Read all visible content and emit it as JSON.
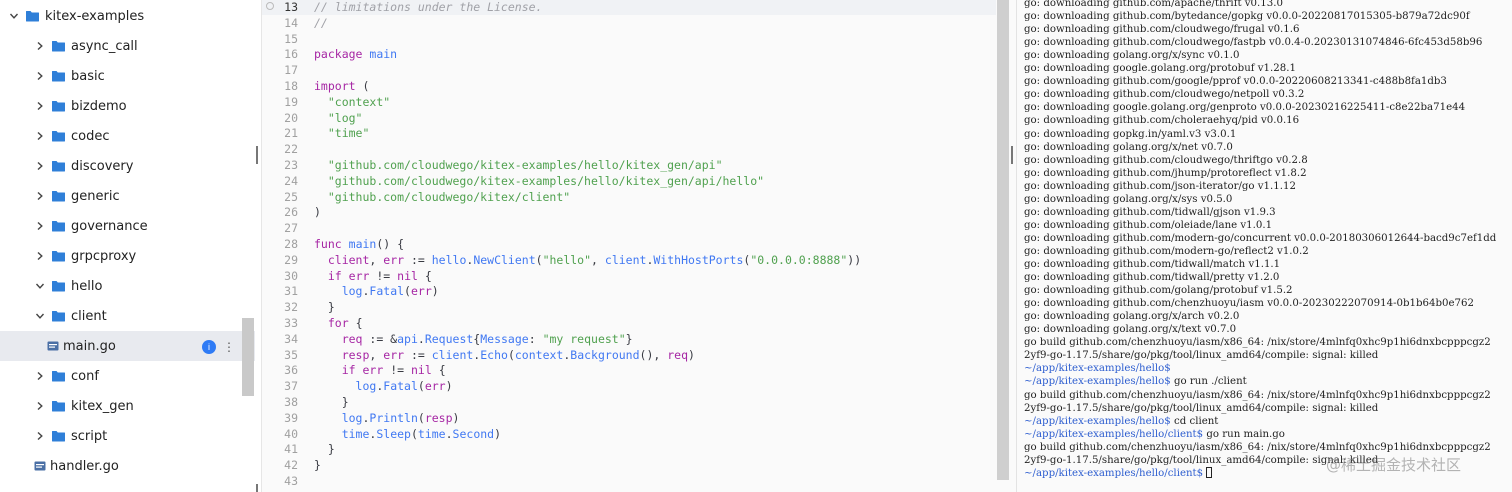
{
  "sidebar": {
    "items": [
      {
        "label": "kitex-examples",
        "type": "folder",
        "expanded": true,
        "depth": 0
      },
      {
        "label": "async_call",
        "type": "folder",
        "expanded": false,
        "depth": 1
      },
      {
        "label": "basic",
        "type": "folder",
        "expanded": false,
        "depth": 1
      },
      {
        "label": "bizdemo",
        "type": "folder",
        "expanded": false,
        "depth": 1
      },
      {
        "label": "codec",
        "type": "folder",
        "expanded": false,
        "depth": 1
      },
      {
        "label": "discovery",
        "type": "folder",
        "expanded": false,
        "depth": 1
      },
      {
        "label": "generic",
        "type": "folder",
        "expanded": false,
        "depth": 1
      },
      {
        "label": "governance",
        "type": "folder",
        "expanded": false,
        "depth": 1
      },
      {
        "label": "grpcproxy",
        "type": "folder",
        "expanded": false,
        "depth": 1
      },
      {
        "label": "hello",
        "type": "folder",
        "expanded": true,
        "depth": 1
      },
      {
        "label": "client",
        "type": "folder",
        "expanded": true,
        "depth": 2
      },
      {
        "label": "main.go",
        "type": "file",
        "selected": true,
        "depth": 3
      },
      {
        "label": "conf",
        "type": "folder",
        "expanded": false,
        "depth": 2
      },
      {
        "label": "kitex_gen",
        "type": "folder",
        "expanded": false,
        "depth": 2
      },
      {
        "label": "script",
        "type": "folder",
        "expanded": false,
        "depth": 2
      },
      {
        "label": "handler.go",
        "type": "file",
        "depth": 2
      }
    ],
    "badge_text": "i",
    "kebab_text": "⋮"
  },
  "editor": {
    "current_line": "13",
    "lines": [
      {
        "n": "13",
        "tokens": [
          [
            "cm",
            "// limitations under the License."
          ]
        ]
      },
      {
        "n": "14",
        "tokens": [
          [
            "cm",
            "//"
          ]
        ]
      },
      {
        "n": "15",
        "tokens": []
      },
      {
        "n": "16",
        "tokens": [
          [
            "kw",
            "package"
          ],
          [
            "op",
            " "
          ],
          [
            "fn",
            "main"
          ]
        ]
      },
      {
        "n": "17",
        "tokens": []
      },
      {
        "n": "18",
        "tokens": [
          [
            "kw",
            "import"
          ],
          [
            "op",
            " ("
          ]
        ]
      },
      {
        "n": "19",
        "tokens": [
          [
            "op",
            "  "
          ],
          [
            "str",
            "\"context\""
          ]
        ]
      },
      {
        "n": "20",
        "tokens": [
          [
            "op",
            "  "
          ],
          [
            "str",
            "\"log\""
          ]
        ]
      },
      {
        "n": "21",
        "tokens": [
          [
            "op",
            "  "
          ],
          [
            "str",
            "\"time\""
          ]
        ]
      },
      {
        "n": "22",
        "tokens": []
      },
      {
        "n": "23",
        "tokens": [
          [
            "op",
            "  "
          ],
          [
            "str",
            "\"github.com/cloudwego/kitex-examples/hello/kitex_gen/api\""
          ]
        ]
      },
      {
        "n": "24",
        "tokens": [
          [
            "op",
            "  "
          ],
          [
            "str",
            "\"github.com/cloudwego/kitex-examples/hello/kitex_gen/api/hello\""
          ]
        ]
      },
      {
        "n": "25",
        "tokens": [
          [
            "op",
            "  "
          ],
          [
            "str",
            "\"github.com/cloudwego/kitex/client\""
          ]
        ]
      },
      {
        "n": "26",
        "tokens": [
          [
            "op",
            ")"
          ]
        ]
      },
      {
        "n": "27",
        "tokens": []
      },
      {
        "n": "28",
        "tokens": [
          [
            "kw",
            "func"
          ],
          [
            "op",
            " "
          ],
          [
            "fn",
            "main"
          ],
          [
            "op",
            "() {"
          ]
        ]
      },
      {
        "n": "29",
        "tokens": [
          [
            "op",
            "  "
          ],
          [
            "kw",
            "client"
          ],
          [
            "op",
            ", "
          ],
          [
            "kw",
            "err"
          ],
          [
            "op",
            " := "
          ],
          [
            "fn",
            "hello"
          ],
          [
            "op",
            "."
          ],
          [
            "fn",
            "NewClient"
          ],
          [
            "op",
            "("
          ],
          [
            "str",
            "\"hello\""
          ],
          [
            "op",
            ", "
          ],
          [
            "fn",
            "client"
          ],
          [
            "op",
            "."
          ],
          [
            "fn",
            "WithHostPorts"
          ],
          [
            "op",
            "("
          ],
          [
            "str",
            "\"0.0.0.0:8888\""
          ],
          [
            "op",
            "))"
          ]
        ]
      },
      {
        "n": "30",
        "tokens": [
          [
            "op",
            "  "
          ],
          [
            "kw",
            "if"
          ],
          [
            "op",
            " "
          ],
          [
            "kw",
            "err"
          ],
          [
            "op",
            " != "
          ],
          [
            "kw",
            "nil"
          ],
          [
            "op",
            " {"
          ]
        ]
      },
      {
        "n": "31",
        "tokens": [
          [
            "op",
            "    "
          ],
          [
            "fn",
            "log"
          ],
          [
            "op",
            "."
          ],
          [
            "fn",
            "Fatal"
          ],
          [
            "op",
            "("
          ],
          [
            "kw",
            "err"
          ],
          [
            "op",
            ")"
          ]
        ]
      },
      {
        "n": "32",
        "tokens": [
          [
            "op",
            "  }"
          ]
        ]
      },
      {
        "n": "33",
        "tokens": [
          [
            "op",
            "  "
          ],
          [
            "kw",
            "for"
          ],
          [
            "op",
            " {"
          ]
        ]
      },
      {
        "n": "34",
        "tokens": [
          [
            "op",
            "    "
          ],
          [
            "kw",
            "req"
          ],
          [
            "op",
            " := &"
          ],
          [
            "fn",
            "api"
          ],
          [
            "op",
            "."
          ],
          [
            "fn",
            "Request"
          ],
          [
            "op",
            "{"
          ],
          [
            "fn",
            "Message"
          ],
          [
            "op",
            ": "
          ],
          [
            "str",
            "\"my request\""
          ],
          [
            "op",
            "}"
          ]
        ]
      },
      {
        "n": "35",
        "tokens": [
          [
            "op",
            "    "
          ],
          [
            "kw",
            "resp"
          ],
          [
            "op",
            ", "
          ],
          [
            "kw",
            "err"
          ],
          [
            "op",
            " := "
          ],
          [
            "fn",
            "client"
          ],
          [
            "op",
            "."
          ],
          [
            "fn",
            "Echo"
          ],
          [
            "op",
            "("
          ],
          [
            "fn",
            "context"
          ],
          [
            "op",
            "."
          ],
          [
            "fn",
            "Background"
          ],
          [
            "op",
            "(), "
          ],
          [
            "kw",
            "req"
          ],
          [
            "op",
            ")"
          ]
        ]
      },
      {
        "n": "36",
        "tokens": [
          [
            "op",
            "    "
          ],
          [
            "kw",
            "if"
          ],
          [
            "op",
            " "
          ],
          [
            "kw",
            "err"
          ],
          [
            "op",
            " != "
          ],
          [
            "kw",
            "nil"
          ],
          [
            "op",
            " {"
          ]
        ]
      },
      {
        "n": "37",
        "tokens": [
          [
            "op",
            "      "
          ],
          [
            "fn",
            "log"
          ],
          [
            "op",
            "."
          ],
          [
            "fn",
            "Fatal"
          ],
          [
            "op",
            "("
          ],
          [
            "kw",
            "err"
          ],
          [
            "op",
            ")"
          ]
        ]
      },
      {
        "n": "38",
        "tokens": [
          [
            "op",
            "    }"
          ]
        ]
      },
      {
        "n": "39",
        "tokens": [
          [
            "op",
            "    "
          ],
          [
            "fn",
            "log"
          ],
          [
            "op",
            "."
          ],
          [
            "fn",
            "Println"
          ],
          [
            "op",
            "("
          ],
          [
            "kw",
            "resp"
          ],
          [
            "op",
            ")"
          ]
        ]
      },
      {
        "n": "40",
        "tokens": [
          [
            "op",
            "    "
          ],
          [
            "fn",
            "time"
          ],
          [
            "op",
            "."
          ],
          [
            "fn",
            "Sleep"
          ],
          [
            "op",
            "("
          ],
          [
            "fn",
            "time"
          ],
          [
            "op",
            "."
          ],
          [
            "fn",
            "Second"
          ],
          [
            "op",
            ")"
          ]
        ]
      },
      {
        "n": "41",
        "tokens": [
          [
            "op",
            "  }"
          ]
        ]
      },
      {
        "n": "42",
        "tokens": [
          [
            "op",
            "}"
          ]
        ]
      },
      {
        "n": "43",
        "tokens": []
      }
    ]
  },
  "terminal": {
    "lines": [
      {
        "text": "go: downloading github.com/apache/thrift v0.13.0"
      },
      {
        "text": "go: downloading github.com/bytedance/gopkg v0.0.0-20220817015305-b879a72dc90f"
      },
      {
        "text": "go: downloading github.com/cloudwego/frugal v0.1.6"
      },
      {
        "text": "go: downloading github.com/cloudwego/fastpb v0.0.4-0.20230131074846-6fc453d58b96"
      },
      {
        "text": "go: downloading golang.org/x/sync v0.1.0"
      },
      {
        "text": "go: downloading google.golang.org/protobuf v1.28.1"
      },
      {
        "text": "go: downloading github.com/google/pprof v0.0.0-20220608213341-c488b8fa1db3"
      },
      {
        "text": "go: downloading github.com/cloudwego/netpoll v0.3.2"
      },
      {
        "text": "go: downloading google.golang.org/genproto v0.0.0-20230216225411-c8e22ba71e44"
      },
      {
        "text": "go: downloading github.com/choleraehyq/pid v0.0.16"
      },
      {
        "text": "go: downloading gopkg.in/yaml.v3 v3.0.1"
      },
      {
        "text": "go: downloading golang.org/x/net v0.7.0"
      },
      {
        "text": "go: downloading github.com/cloudwego/thriftgo v0.2.8"
      },
      {
        "text": "go: downloading github.com/jhump/protoreflect v1.8.2"
      },
      {
        "text": "go: downloading github.com/json-iterator/go v1.1.12"
      },
      {
        "text": "go: downloading golang.org/x/sys v0.5.0"
      },
      {
        "text": "go: downloading github.com/tidwall/gjson v1.9.3"
      },
      {
        "text": "go: downloading github.com/oleiade/lane v1.0.1"
      },
      {
        "text": "go: downloading github.com/modern-go/concurrent v0.0.0-20180306012644-bacd9c7ef1dd"
      },
      {
        "text": "go: downloading github.com/modern-go/reflect2 v1.0.2"
      },
      {
        "text": "go: downloading github.com/tidwall/match v1.1.1"
      },
      {
        "text": "go: downloading github.com/tidwall/pretty v1.2.0"
      },
      {
        "text": "go: downloading github.com/golang/protobuf v1.5.2"
      },
      {
        "text": "go: downloading github.com/chenzhuoyu/iasm v0.0.0-20230222070914-0b1b64b0e762"
      },
      {
        "text": "go: downloading golang.org/x/arch v0.2.0"
      },
      {
        "text": "go: downloading golang.org/x/text v0.7.0"
      },
      {
        "text": "go build github.com/chenzhuoyu/iasm/x86_64: /nix/store/4mlnfq0xhc9p1hi6dnxbcpppcgz2"
      },
      {
        "text": "2yf9-go-1.17.5/share/go/pkg/tool/linux_amd64/compile: signal: killed"
      },
      {
        "prompt": "~/app/kitex-examples/hello$",
        "cmd": ""
      },
      {
        "prompt": "~/app/kitex-examples/hello$",
        "cmd": " go run ./client"
      },
      {
        "text": "go build github.com/chenzhuoyu/iasm/x86_64: /nix/store/4mlnfq0xhc9p1hi6dnxbcpppcgz2"
      },
      {
        "text": "2yf9-go-1.17.5/share/go/pkg/tool/linux_amd64/compile: signal: killed"
      },
      {
        "prompt": "~/app/kitex-examples/hello$",
        "cmd": " cd client"
      },
      {
        "prompt": "~/app/kitex-examples/hello/client$",
        "cmd": " go run main.go"
      },
      {
        "text": "go build github.com/chenzhuoyu/iasm/x86_64: /nix/store/4mlnfq0xhc9p1hi6dnxbcpppcgz2"
      },
      {
        "text": "2yf9-go-1.17.5/share/go/pkg/tool/linux_amd64/compile: signal: killed"
      },
      {
        "prompt": "~/app/kitex-examples/hello/client$",
        "cmd": " ",
        "cursor": true
      }
    ],
    "watermark": "@稀土掘金技术社区"
  },
  "colors": {
    "folder": "#2f7fd8",
    "prompt": "#2f5fd0",
    "keyword": "#a626a4",
    "string": "#50a14f",
    "function": "#4078f2",
    "comment": "#a0a1a7"
  }
}
